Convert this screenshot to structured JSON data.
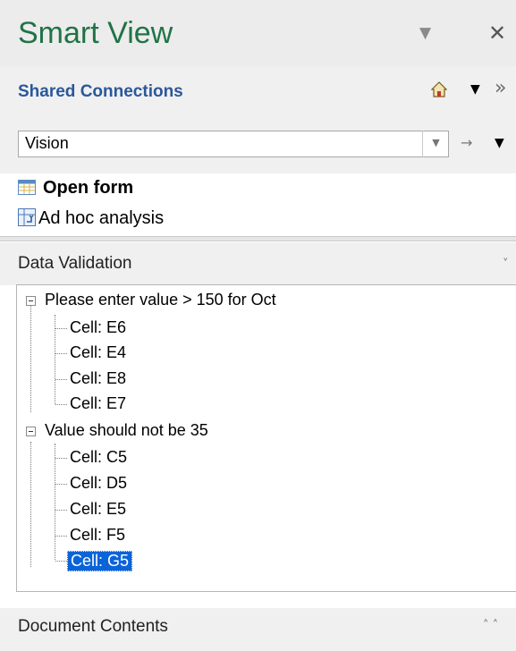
{
  "header": {
    "title": "Smart View",
    "dropdown_icon": "▼",
    "close_icon": "✕"
  },
  "shared_connections": {
    "title": "Shared Connections",
    "home_icon": "home-icon",
    "menu_icon": "▼",
    "more_icon": "»",
    "select_value": "Vision",
    "go_icon": "→",
    "dropdown_icon": "▼"
  },
  "actions": [
    {
      "label": "Open form",
      "icon": "form-grid-icon"
    },
    {
      "label": "Ad hoc analysis",
      "icon": "adhoc-icon"
    }
  ],
  "data_validation": {
    "title": "Data Validation",
    "chevron": "˅",
    "groups": [
      {
        "label": "Please enter value > 150 for Oct",
        "cells": [
          "Cell:  E6",
          "Cell:  E4",
          "Cell:  E8",
          "Cell:  E7"
        ]
      },
      {
        "label": "Value should not be 35",
        "cells": [
          "Cell:  C5",
          "Cell:  D5",
          "Cell:  E5",
          "Cell:  F5",
          "Cell:  G5"
        ]
      }
    ]
  },
  "document_contents": {
    "title": "Document Contents",
    "chevrons": "˄ ˄"
  },
  "colors": {
    "brand": "#217346",
    "link": "#2b579a",
    "selection": "#0a64d8"
  }
}
